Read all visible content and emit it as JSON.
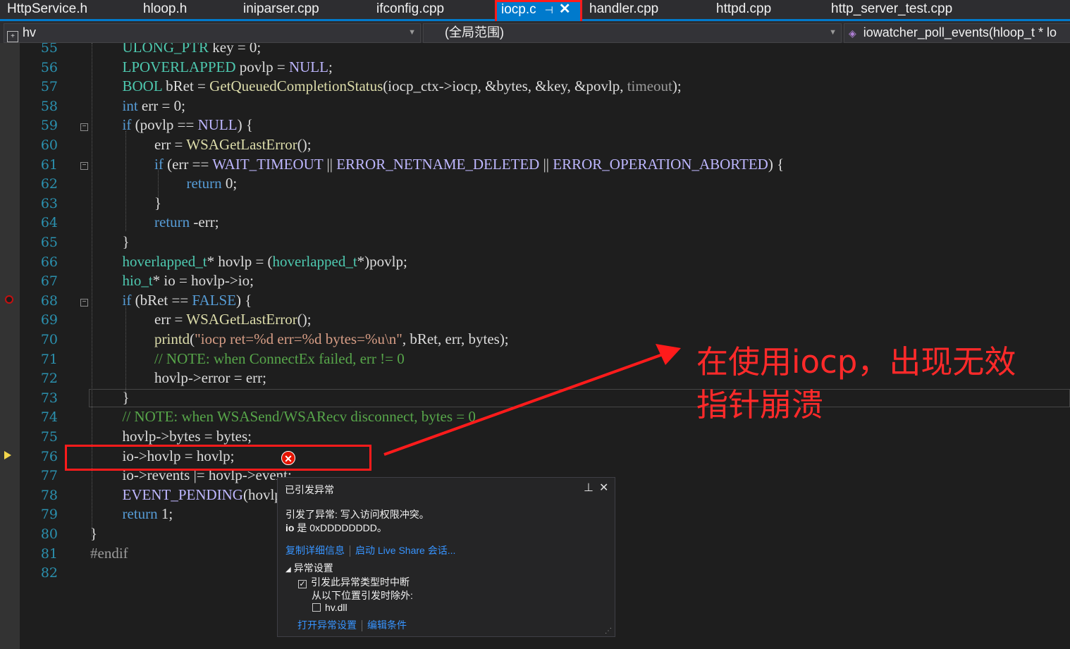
{
  "tabs": [
    {
      "label": "HttpService.h"
    },
    {
      "label": "hloop.h"
    },
    {
      "label": "iniparser.cpp"
    },
    {
      "label": "ifconfig.cpp"
    },
    {
      "label": "iocp.c",
      "active": true
    },
    {
      "label": "handler.cpp"
    },
    {
      "label": "httpd.cpp"
    },
    {
      "label": "http_server_test.cpp"
    }
  ],
  "navbar": {
    "project": "hv",
    "scope": "(全局范围)",
    "function": "iowatcher_poll_events(hloop_t * lo"
  },
  "editor": {
    "line_numbers": [
      "55",
      "56",
      "57",
      "58",
      "59",
      "60",
      "61",
      "62",
      "63",
      "64",
      "65",
      "66",
      "67",
      "68",
      "69",
      "70",
      "71",
      "72",
      "73",
      "74",
      "75",
      "76",
      "77",
      "78",
      "79",
      "80",
      "81",
      "82"
    ],
    "breakpoint_line": "68",
    "current_line": "76",
    "code_lines": [
      "ULONG_PTR key = 0;",
      "LPOVERLAPPED povlp = NULL;",
      "BOOL bRet = GetQueuedCompletionStatus(iocp_ctx->iocp, &bytes, &key, &povlp, timeout);",
      "int err = 0;",
      "if (povlp == NULL) {",
      "err = WSAGetLastError();",
      "if (err == WAIT_TIMEOUT || ERROR_NETNAME_DELETED || ERROR_OPERATION_ABORTED) {",
      "return 0;",
      "}",
      "return -err;",
      "}",
      "hoverlapped_t* hovlp = (hoverlapped_t*)povlp;",
      "hio_t* io = hovlp->io;",
      "if (bRet == FALSE) {",
      "err = WSAGetLastError();",
      "printd(\"iocp ret=%d err=%d bytes=%u\\n\", bRet, err, bytes);",
      "// NOTE: when ConnectEx failed, err != 0",
      "hovlp->error = err;",
      "}",
      "// NOTE: when WSASend/WSARecv disconnect, bytes = 0",
      "hovlp->bytes = bytes;",
      "io->hovlp = hovlp;",
      "io->revents |= hovlp->event;",
      "EVENT_PENDING(hovlp->io);",
      "return 1;",
      "}",
      "#endif",
      ""
    ]
  },
  "annotation": {
    "text_line1": "在使用iocp，出现无效",
    "text_line2": "指针崩溃",
    "color": "#ff1b1b"
  },
  "exception_popup": {
    "title": "已引发异常",
    "message": "引发了异常: 写入访问权限冲突。",
    "detail_var": "io",
    "detail_rest": " 是 0xDDDDDDDD。",
    "link_copy": "复制详细信息",
    "link_liveshare": "启动 Live Share 会话...",
    "settings_header": "异常设置",
    "break_option": "引发此异常类型时中断",
    "break_checked": true,
    "except_label": "从以下位置引发时除外:",
    "module_option": "hv.dll",
    "module_checked": false,
    "link_open_settings": "打开异常设置",
    "link_edit_conditions": "编辑条件"
  }
}
